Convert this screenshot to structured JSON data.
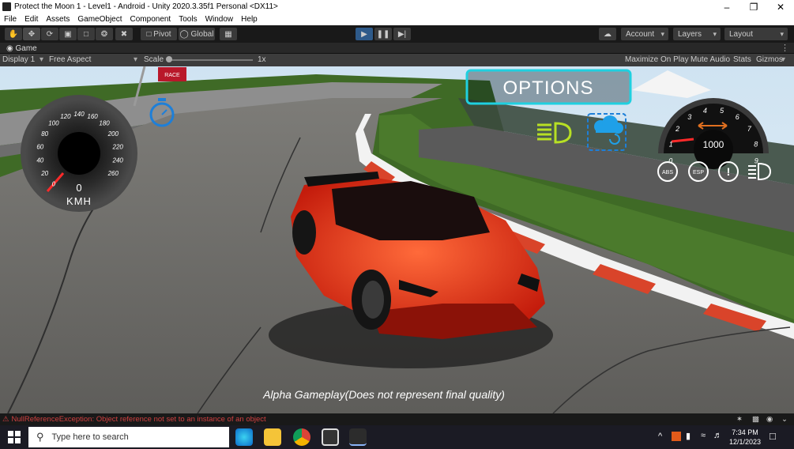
{
  "window": {
    "title": "Protect the Moon 1 - Level1 - Android - Unity 2020.3.35f1 Personal <DX11>"
  },
  "menu": [
    "File",
    "Edit",
    "Assets",
    "GameObject",
    "Component",
    "Tools",
    "Window",
    "Help"
  ],
  "toolbar": {
    "pivot_label": "Pivot",
    "global_label": "Global",
    "account_label": "Account",
    "layers_label": "Layers",
    "layout_label": "Layout"
  },
  "game_tab": {
    "label": "Game",
    "display": "Display 1",
    "aspect": "Free Aspect",
    "scale_label": "Scale",
    "scale_value": "1x",
    "maximize_on_play": "Maximize On Play",
    "mute_audio": "Mute Audio",
    "stats": "Stats",
    "gizmos": "Gizmos"
  },
  "hud": {
    "options_label": "OPTIONS",
    "speed_value": "0",
    "speed_unit": "KMH",
    "speedo_ticks": [
      "0",
      "20",
      "40",
      "60",
      "80",
      "100",
      "120",
      "140",
      "160",
      "180",
      "200",
      "220",
      "240",
      "260"
    ],
    "rpm_value": "1000",
    "rpm_ticks": [
      "0",
      "1",
      "2",
      "3",
      "4",
      "5",
      "6",
      "7",
      "8",
      "9"
    ],
    "abs_label": "ABS",
    "esp_label": "ESP",
    "race_sign": "RACE",
    "watermark": "Alpha Gameplay(Does not represent final quality)"
  },
  "status": {
    "error": "NullReferenceException: Object reference not set to an instance of an object"
  },
  "taskbar": {
    "search_placeholder": "Type here to search",
    "time": "7:34 PM",
    "date": "12/1/2023"
  },
  "colors": {
    "accent_cyan": "#1fd0e0",
    "play_blue": "#2e5a8a",
    "error_red": "#d04040",
    "car_red": "#e8351e"
  }
}
